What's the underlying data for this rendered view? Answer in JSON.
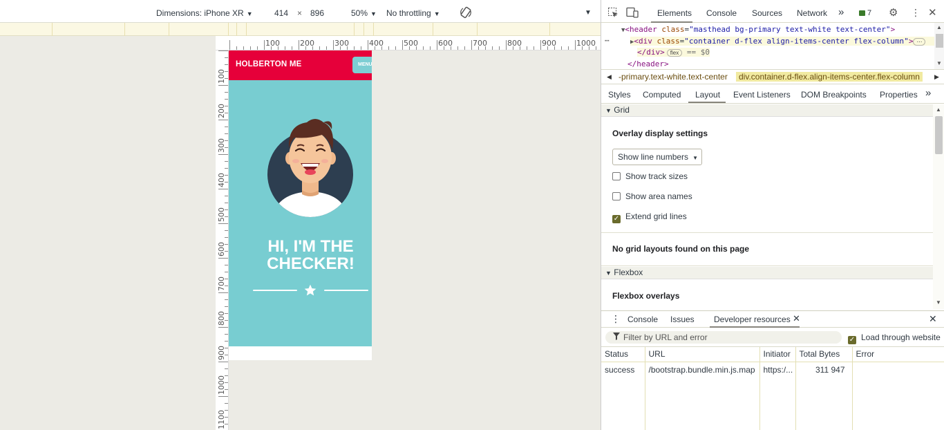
{
  "device_toolbar": {
    "dimensions_label": "Dimensions: iPhone XR",
    "width": "414",
    "times": "×",
    "height": "896",
    "zoom": "50%",
    "throttling": "No throttling"
  },
  "rulers": {
    "h_marks": [
      "100",
      "200",
      "300",
      "400",
      "500",
      "600",
      "700",
      "800",
      "900",
      "1000"
    ],
    "v_marks": [
      "100",
      "200",
      "300",
      "400",
      "500",
      "600",
      "700",
      "800",
      "900",
      "1000",
      "1100"
    ]
  },
  "site": {
    "brand": "HOLBERTON ME",
    "menu_label": "MENU",
    "hero_line1": "HI, I'M THE",
    "hero_line2": "CHECKER!",
    "colors": {
      "primary": "#e6003a",
      "secondary": "#78cdd1"
    }
  },
  "devtools": {
    "tabs": [
      "Elements",
      "Console",
      "Sources",
      "Network"
    ],
    "more": "»",
    "issue_count": "7",
    "dom": {
      "line1_tag_open": "<header",
      "line1_attr": "class",
      "line1_val": "\"masthead bg-primary text-white text-center\"",
      "line2_tag_open": "<div",
      "line2_attr": "class",
      "line2_val": "\"container d-flex align-items-center flex-column\"",
      "line3_close": "</div>",
      "line3_badge": "flex",
      "line3_eq": "== $0",
      "line4_close": "</header>"
    },
    "breadcrumb": {
      "crumb1": "-primary.text-white.text-center",
      "crumb2": "div.container.d-flex.align-items-center.flex-column"
    },
    "subtabs": [
      "Styles",
      "Computed",
      "Layout",
      "Event Listeners",
      "DOM Breakpoints",
      "Properties"
    ],
    "layout": {
      "grid_heading": "Grid",
      "overlay_title": "Overlay display settings",
      "line_select": "Show line numbers",
      "show_track_sizes": "Show track sizes",
      "show_area_names": "Show area names",
      "extend_grid_lines": "Extend grid lines",
      "no_grid": "No grid layouts found on this page",
      "flexbox_heading": "Flexbox",
      "flexbox_overlays": "Flexbox overlays"
    },
    "drawer": {
      "tabs": [
        "Console",
        "Issues",
        "Developer resources"
      ],
      "filter_placeholder": "Filter by URL and error",
      "load_through": "Load through website"
    },
    "table": {
      "headers": [
        "Status",
        "URL",
        "Initiator",
        "Total Bytes",
        "Error"
      ],
      "rows": [
        {
          "status": "success",
          "url": "/bootstrap.bundle.min.js.map",
          "initiator": "https:/...",
          "bytes": "311 947",
          "error": ""
        }
      ]
    }
  }
}
